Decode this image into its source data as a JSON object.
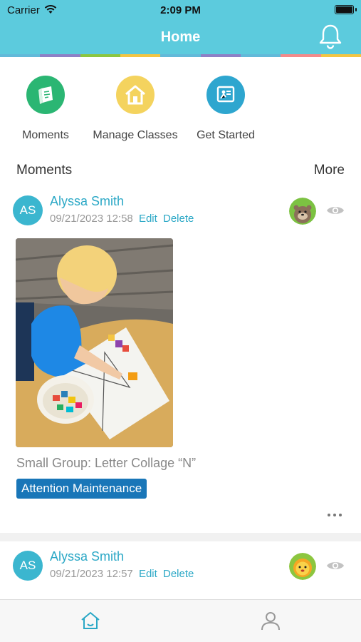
{
  "status_bar": {
    "carrier": "Carrier",
    "time": "2:09 PM"
  },
  "header": {
    "title": "Home",
    "notification_icon": "bell-icon"
  },
  "quick_actions": [
    {
      "label": "Moments",
      "icon": "moments-book-icon",
      "color": "#2bb673"
    },
    {
      "label": "Manage Classes",
      "icon": "house-icon",
      "color": "#f4d35e"
    },
    {
      "label": "Get Started",
      "icon": "presentation-board-icon",
      "color": "#2ea6cf"
    }
  ],
  "moments_section": {
    "title": "Moments",
    "more_label": "More"
  },
  "posts": [
    {
      "avatar_initials": "AS",
      "author": "Alyssa Smith",
      "timestamp": "09/21/2023 12:58",
      "edit_label": "Edit",
      "delete_label": "Delete",
      "student_icon": "otter-avatar-icon",
      "visibility_icon": "eye-icon",
      "caption": "Small Group: Letter Collage “N”",
      "tag": "Attention Maintenance",
      "more_icon": "more-dots-icon"
    },
    {
      "avatar_initials": "AS",
      "author": "Alyssa Smith",
      "timestamp": "09/21/2023 12:57",
      "edit_label": "Edit",
      "delete_label": "Delete",
      "student_icon": "lion-avatar-icon",
      "visibility_icon": "eye-icon"
    }
  ],
  "tab_bar": [
    {
      "icon": "home-icon",
      "active": true
    },
    {
      "icon": "profile-icon",
      "active": false
    }
  ],
  "colors": {
    "header": "#5ccbdd",
    "accent": "#2ba8c6",
    "tag": "#1976b8"
  }
}
